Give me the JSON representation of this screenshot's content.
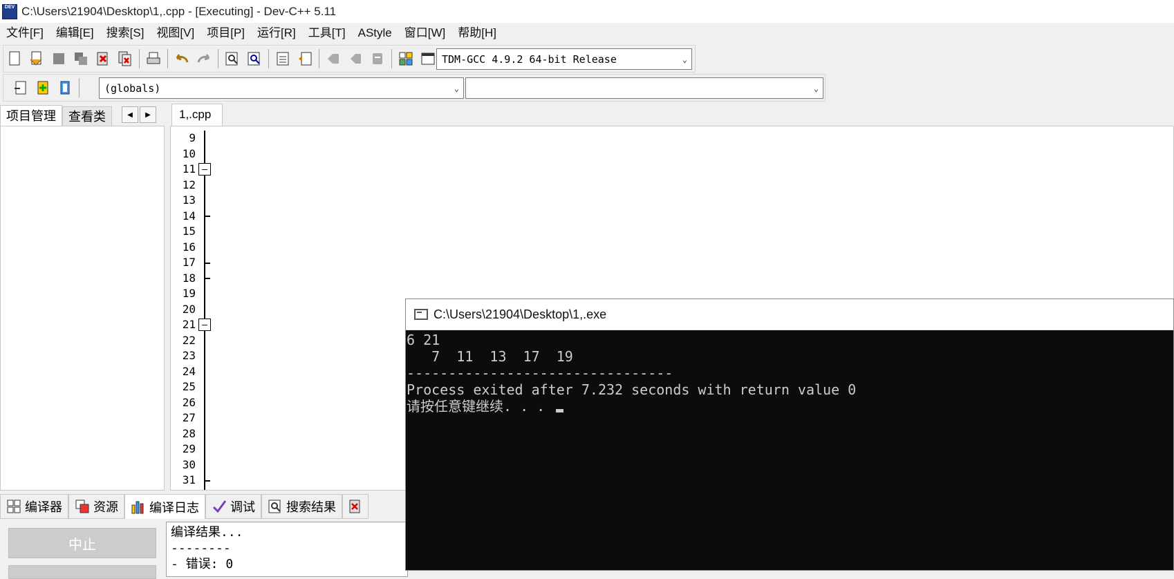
{
  "window": {
    "title": "C:\\Users\\21904\\Desktop\\1,.cpp - [Executing] - Dev-C++ 5.11",
    "logo_text": "DEV"
  },
  "menu": [
    "文件[F]",
    "编辑[E]",
    "搜索[S]",
    "视图[V]",
    "项目[P]",
    "运行[R]",
    "工具[T]",
    "AStyle",
    "窗口[W]",
    "帮助[H]"
  ],
  "toolbar": {
    "compiler_select": "TDM-GCC 4.9.2 64-bit Release"
  },
  "toolbar2": {
    "scope_select": "(globals)",
    "symbol_select": ""
  },
  "left_panel": {
    "tabs": [
      "项目管理",
      "查看类"
    ]
  },
  "editor": {
    "file_tab": "1,.cpp",
    "line_numbers": [
      "9",
      "10",
      "11",
      "12",
      "13",
      "14",
      "15",
      "16",
      "17",
      "18",
      "19",
      "20",
      "21",
      "22",
      "23",
      "24",
      "25",
      "26",
      "27",
      "28",
      "29",
      "30",
      "31"
    ]
  },
  "bottom_tabs": [
    "编译器",
    "资源",
    "编译日志",
    "调试",
    "搜索结果"
  ],
  "stop_button": "中止",
  "compile_log": [
    "编译结果...",
    "--------",
    "- 错误: 0"
  ],
  "console": {
    "title": "C:\\Users\\21904\\Desktop\\1,.exe",
    "lines": [
      "6 21",
      "   7  11  13  17  19",
      "--------------------------------",
      "Process exited after 7.232 seconds with return value 0",
      "请按任意键继续. . . "
    ]
  },
  "colors": {
    "keyword": "#000000",
    "operator": "#e00000",
    "string": "#0000ff",
    "active_line": "#ccfbfb",
    "console_bg": "#0c0c0c"
  }
}
